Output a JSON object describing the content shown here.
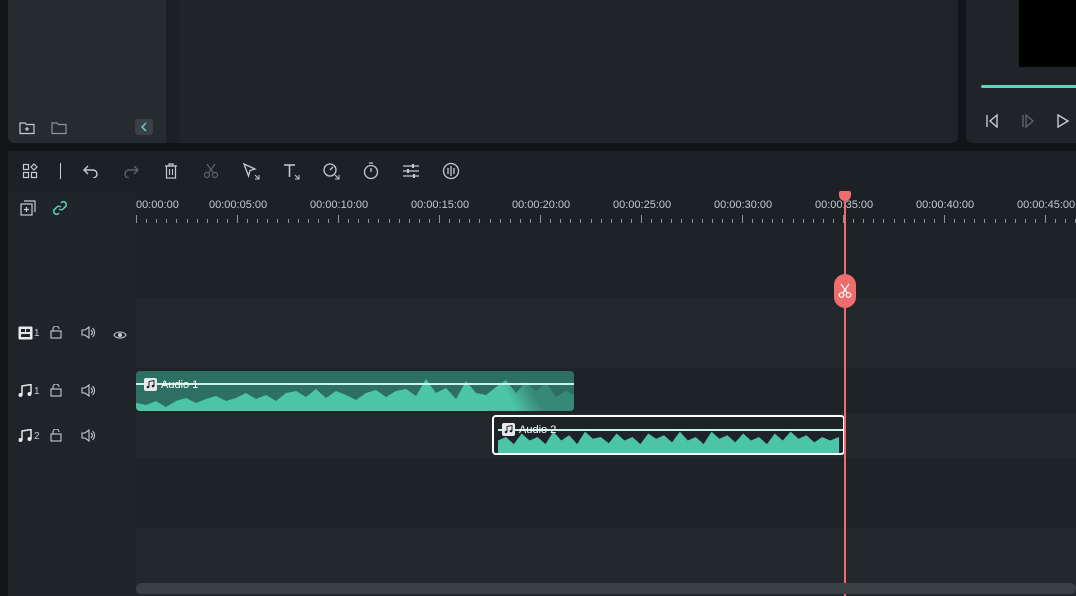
{
  "timeline": {
    "ruler_labels": [
      "00:00:00",
      "00:00:05:00",
      "00:00:10:00",
      "00:00:15:00",
      "00:00:20:00",
      "00:00:25:00",
      "00:00:30:00",
      "00:00:35:00",
      "00:00:40:00",
      "00:00:45:00"
    ],
    "tracks": {
      "video1": {
        "number": "1"
      },
      "audio1": {
        "number": "1"
      },
      "audio2": {
        "number": "2"
      }
    },
    "clips": {
      "audio1": {
        "label": "Audio 1"
      },
      "audio2": {
        "label": "Audio 2"
      }
    }
  },
  "colors": {
    "accent": "#5fd4bd",
    "playhead": "#f06d6d",
    "clip_wave": "#4cc4a7"
  },
  "icons": [
    "new-folder-icon",
    "folder-icon",
    "chevron-left-icon",
    "frame-back-icon",
    "frame-forward-icon",
    "play-icon",
    "layout-icon",
    "undo-icon",
    "redo-icon",
    "delete-icon",
    "cut-icon",
    "select-tool-icon",
    "text-icon",
    "speed-icon",
    "duration-icon",
    "adjust-icon",
    "audio-icon",
    "add-track-icon",
    "link-icon",
    "video-track-icon",
    "lock-icon",
    "speaker-icon",
    "eye-icon",
    "music-icon",
    "scissors-icon"
  ]
}
